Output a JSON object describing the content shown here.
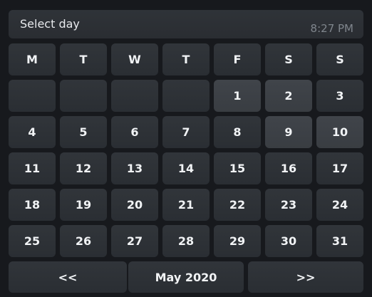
{
  "header": {
    "title": "Select day",
    "time": "8:27 PM"
  },
  "weekdays": [
    "M",
    "T",
    "W",
    "T",
    "F",
    "S",
    "S"
  ],
  "weeks": [
    [
      "",
      "",
      "",
      "",
      "1",
      "2",
      "3"
    ],
    [
      "4",
      "5",
      "6",
      "7",
      "8",
      "9",
      "10"
    ],
    [
      "11",
      "12",
      "13",
      "14",
      "15",
      "16",
      "17"
    ],
    [
      "18",
      "19",
      "20",
      "21",
      "22",
      "23",
      "24"
    ],
    [
      "25",
      "26",
      "27",
      "28",
      "29",
      "30",
      "31"
    ]
  ],
  "highlighted_days": [
    "1",
    "2",
    "9",
    "10"
  ],
  "footer": {
    "prev_label": "<<",
    "month_label": "May 2020",
    "next_label": ">>"
  },
  "colors": {
    "background": "#17191d",
    "cell": "#2d3136",
    "cell_highlight": "#3d4146",
    "text": "#f1f3f5",
    "time_text": "#7f858c"
  }
}
